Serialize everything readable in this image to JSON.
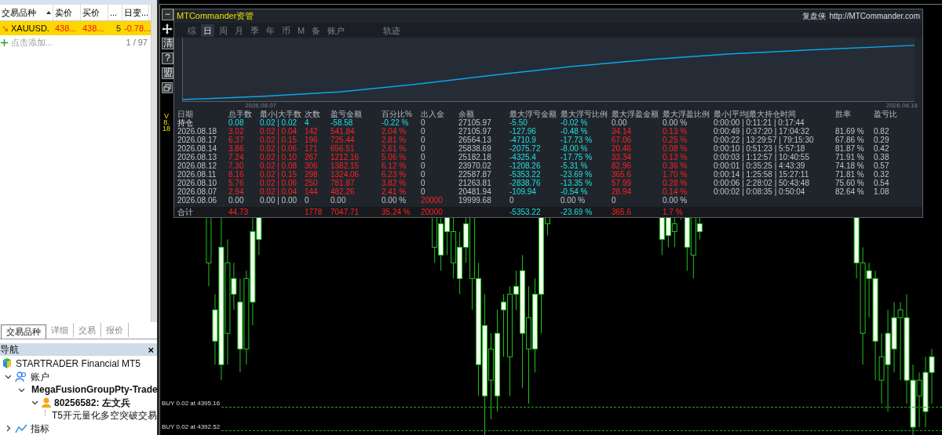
{
  "market_watch": {
    "columns": [
      {
        "label": "交易品种",
        "sorted": true
      },
      {
        "label": "卖价",
        "sorted": false
      },
      {
        "label": "买价",
        "sorted": false
      },
      {
        "label": "...",
        "sorted": false
      },
      {
        "label": "日变...",
        "sorted": false
      }
    ],
    "rows": [
      {
        "selected": true,
        "arrow": "↘",
        "cells": [
          "XAUUSD.",
          "438...",
          "438...",
          "5",
          "-0.78..."
        ]
      }
    ],
    "add_label": "点击添加...",
    "count": "1 / 97"
  },
  "bottom_tabs": [
    {
      "label": "交易品种",
      "selected": true
    },
    {
      "label": "详细",
      "selected": false
    },
    {
      "label": "交易",
      "selected": false
    },
    {
      "label": "报价",
      "selected": false
    }
  ],
  "navigator": {
    "title": "导航",
    "close": "×",
    "tree": [
      {
        "label": "STARTRADER Financial MT5",
        "kind": "broker",
        "bold": false,
        "children": [
          {
            "label": "账户",
            "kind": "accounts",
            "bold": false,
            "expanded": true,
            "children": [
              {
                "label": "MegaFusionGroupPty-Trade",
                "kind": "server",
                "bold": true,
                "expanded": true,
                "children": [
                  {
                    "label": "80256582: 左文兵",
                    "kind": "user",
                    "bold": true,
                    "expanded": true,
                    "children": [
                      {
                        "label": "T5开元量化多空突破交易",
                        "kind": "expert",
                        "bold": false
                      }
                    ]
                  }
                ]
              }
            ]
          },
          {
            "label": "指标",
            "kind": "indicators",
            "bold": false,
            "expanded": false
          }
        ]
      }
    ]
  },
  "chart_toolbar": [
    {
      "kind": "minimize",
      "label": "−"
    },
    {
      "kind": "move"
    },
    {
      "kind": "text",
      "label": "清"
    },
    {
      "kind": "text",
      "label": "?"
    },
    {
      "kind": "text",
      "label": "盟"
    },
    {
      "kind": "restore"
    }
  ],
  "version": "V8.18",
  "panel": {
    "title": "MTCommander资管",
    "brand": "复盘侠",
    "url": "http://MTCommander.com",
    "tabs": [
      {
        "label": "综",
        "selected": false
      },
      {
        "label": "日",
        "selected": true
      },
      {
        "label": "周",
        "selected": false
      },
      {
        "label": "月",
        "selected": false
      },
      {
        "label": "季",
        "selected": false
      },
      {
        "label": "年",
        "selected": false
      },
      {
        "label": "币",
        "selected": false
      },
      {
        "label": "M",
        "selected": false
      },
      {
        "label": "备",
        "selected": false
      },
      {
        "label": "账户",
        "selected": false
      },
      {
        "label": "轨迹",
        "selected": false
      }
    ],
    "curve": {
      "start_label": "2026.08.07",
      "end_label": "2026.08.18"
    },
    "columns": [
      "日期",
      "总手数",
      "最小|大手数",
      "次数",
      "盈亏金额",
      "百分比%",
      "出入金",
      "余额",
      "最大浮亏金额",
      "最大浮亏比例",
      "最大浮盈金额",
      "最大浮盈比例",
      "最小|平均|最大持仓时间",
      "胜率",
      "盈亏比"
    ],
    "rows": [
      {
        "kind": "holding",
        "cells": [
          {
            "text": "持仓",
            "kind": "label"
          },
          {
            "text": "0.08",
            "kind": "down"
          },
          {
            "text": "0.02 | 0.02",
            "kind": "down"
          },
          {
            "text": "4",
            "kind": "down"
          },
          {
            "text": "-58.58",
            "kind": "down"
          },
          {
            "text": "-0.22 %",
            "kind": "down"
          },
          {
            "text": "0",
            "kind": "flat"
          },
          {
            "text": "27105.97",
            "kind": "flat"
          },
          {
            "text": "-5.50",
            "kind": "down"
          },
          {
            "text": "-0.02 %",
            "kind": "down"
          },
          {
            "text": "0.00",
            "kind": "flat"
          },
          {
            "text": "0.00 %",
            "kind": "flat"
          },
          {
            "text": "0:00:00 | 0:11:21 | 0:17:44",
            "kind": "flat"
          },
          null,
          null
        ]
      },
      {
        "kind": "day",
        "cells": [
          {
            "text": "2026.08.18",
            "kind": "flat"
          },
          {
            "text": "3.02",
            "kind": "up"
          },
          {
            "text": "0.02 | 0.04",
            "kind": "up"
          },
          {
            "text": "142",
            "kind": "up"
          },
          {
            "text": "541.84",
            "kind": "up"
          },
          {
            "text": "2.04 %",
            "kind": "up"
          },
          {
            "text": "0",
            "kind": "flat"
          },
          {
            "text": "27105.97",
            "kind": "flat"
          },
          {
            "text": "-127.96",
            "kind": "down"
          },
          {
            "text": "-0.48 %",
            "kind": "down"
          },
          {
            "text": "34.14",
            "kind": "up"
          },
          {
            "text": "0.13 %",
            "kind": "up"
          },
          {
            "text": "0:00:49 | 0:37:20 | 17:04:32",
            "kind": "flat"
          },
          {
            "text": "81.69 %",
            "kind": "flat"
          },
          {
            "text": "0.82",
            "kind": "flat"
          }
        ]
      },
      {
        "kind": "day",
        "cells": [
          {
            "text": "2026.08.17",
            "kind": "flat"
          },
          {
            "text": "6.37",
            "kind": "up"
          },
          {
            "text": "0.02 | 0.15",
            "kind": "up"
          },
          {
            "text": "196",
            "kind": "up"
          },
          {
            "text": "725.44",
            "kind": "up"
          },
          {
            "text": "2.81 %",
            "kind": "up"
          },
          {
            "text": "0",
            "kind": "flat"
          },
          {
            "text": "26564.13",
            "kind": "flat"
          },
          {
            "text": "-4710.9",
            "kind": "down"
          },
          {
            "text": "-17.73 %",
            "kind": "down"
          },
          {
            "text": "67.06",
            "kind": "up"
          },
          {
            "text": "0.25 %",
            "kind": "up"
          },
          {
            "text": "0:00:22 | 13:29:57 | 79:15:30",
            "kind": "flat"
          },
          {
            "text": "67.86 %",
            "kind": "flat"
          },
          {
            "text": "0.29",
            "kind": "flat"
          }
        ]
      },
      {
        "kind": "day",
        "cells": [
          {
            "text": "2026.08.14",
            "kind": "flat"
          },
          {
            "text": "3.86",
            "kind": "up"
          },
          {
            "text": "0.02 | 0.06",
            "kind": "up"
          },
          {
            "text": "171",
            "kind": "up"
          },
          {
            "text": "656.51",
            "kind": "up"
          },
          {
            "text": "2.61 %",
            "kind": "up"
          },
          {
            "text": "0",
            "kind": "flat"
          },
          {
            "text": "25838.69",
            "kind": "flat"
          },
          {
            "text": "-2075.72",
            "kind": "down"
          },
          {
            "text": "-8.00 %",
            "kind": "down"
          },
          {
            "text": "20.46",
            "kind": "up"
          },
          {
            "text": "0.08 %",
            "kind": "up"
          },
          {
            "text": "0:00:10 | 0:51:23 | 5:57:18",
            "kind": "flat"
          },
          {
            "text": "81.87 %",
            "kind": "flat"
          },
          {
            "text": "0.42",
            "kind": "flat"
          }
        ]
      },
      {
        "kind": "day",
        "cells": [
          {
            "text": "2026.08.13",
            "kind": "flat"
          },
          {
            "text": "7.24",
            "kind": "up"
          },
          {
            "text": "0.02 | 0.10",
            "kind": "up"
          },
          {
            "text": "267",
            "kind": "up"
          },
          {
            "text": "1212.16",
            "kind": "up"
          },
          {
            "text": "5.06 %",
            "kind": "up"
          },
          {
            "text": "0",
            "kind": "flat"
          },
          {
            "text": "25182.18",
            "kind": "flat"
          },
          {
            "text": "-4325.4",
            "kind": "down"
          },
          {
            "text": "-17.75 %",
            "kind": "down"
          },
          {
            "text": "33.34",
            "kind": "up"
          },
          {
            "text": "0.13 %",
            "kind": "up"
          },
          {
            "text": "0:00:03 | 1:12:57 | 10:40:55",
            "kind": "flat"
          },
          {
            "text": "71.91 %",
            "kind": "flat"
          },
          {
            "text": "0.38",
            "kind": "flat"
          }
        ]
      },
      {
        "kind": "day",
        "cells": [
          {
            "text": "2026.08.12",
            "kind": "flat"
          },
          {
            "text": "7.30",
            "kind": "up"
          },
          {
            "text": "0.02 | 0.08",
            "kind": "up"
          },
          {
            "text": "306",
            "kind": "up"
          },
          {
            "text": "1382.15",
            "kind": "up"
          },
          {
            "text": "6.12 %",
            "kind": "up"
          },
          {
            "text": "0",
            "kind": "flat"
          },
          {
            "text": "23970.02",
            "kind": "flat"
          },
          {
            "text": "-1208.26",
            "kind": "down"
          },
          {
            "text": "-5.31 %",
            "kind": "down"
          },
          {
            "text": "82.96",
            "kind": "up"
          },
          {
            "text": "0.36 %",
            "kind": "up"
          },
          {
            "text": "0:00:01 | 0:35:25 | 4:43:39",
            "kind": "flat"
          },
          {
            "text": "74.18 %",
            "kind": "flat"
          },
          {
            "text": "0.57",
            "kind": "flat"
          }
        ]
      },
      {
        "kind": "day",
        "cells": [
          {
            "text": "2026.08.11",
            "kind": "flat"
          },
          {
            "text": "8.16",
            "kind": "up"
          },
          {
            "text": "0.02 | 0.15",
            "kind": "up"
          },
          {
            "text": "298",
            "kind": "up"
          },
          {
            "text": "1324.06",
            "kind": "up"
          },
          {
            "text": "6.23 %",
            "kind": "up"
          },
          {
            "text": "0",
            "kind": "flat"
          },
          {
            "text": "22587.87",
            "kind": "flat"
          },
          {
            "text": "-5353.22",
            "kind": "down"
          },
          {
            "text": "-23.69 %",
            "kind": "down"
          },
          {
            "text": "365.6",
            "kind": "up"
          },
          {
            "text": "1.70 %",
            "kind": "up"
          },
          {
            "text": "0:00:14 | 1:25:58 | 15:27:11",
            "kind": "flat"
          },
          {
            "text": "71.81 %",
            "kind": "flat"
          },
          {
            "text": "0.32",
            "kind": "flat"
          }
        ]
      },
      {
        "kind": "day",
        "cells": [
          {
            "text": "2026.08.10",
            "kind": "flat"
          },
          {
            "text": "5.76",
            "kind": "up"
          },
          {
            "text": "0.02 | 0.06",
            "kind": "up"
          },
          {
            "text": "250",
            "kind": "up"
          },
          {
            "text": "781.87",
            "kind": "up"
          },
          {
            "text": "3.82 %",
            "kind": "up"
          },
          {
            "text": "0",
            "kind": "flat"
          },
          {
            "text": "21263.81",
            "kind": "flat"
          },
          {
            "text": "-2838.76",
            "kind": "down"
          },
          {
            "text": "-13.35 %",
            "kind": "down"
          },
          {
            "text": "57.99",
            "kind": "up"
          },
          {
            "text": "0.28 %",
            "kind": "up"
          },
          {
            "text": "0:00:06 | 2:28:02 | 50:43:48",
            "kind": "flat"
          },
          {
            "text": "75.60 %",
            "kind": "flat"
          },
          {
            "text": "0.54",
            "kind": "flat"
          }
        ]
      },
      {
        "kind": "day",
        "cells": [
          {
            "text": "2026.08.07",
            "kind": "flat"
          },
          {
            "text": "2.94",
            "kind": "up"
          },
          {
            "text": "0.02 | 0.04",
            "kind": "up"
          },
          {
            "text": "144",
            "kind": "up"
          },
          {
            "text": "482.26",
            "kind": "up"
          },
          {
            "text": "2.41 %",
            "kind": "up"
          },
          {
            "text": "0",
            "kind": "flat"
          },
          {
            "text": "20481.94",
            "kind": "flat"
          },
          {
            "text": "-109.94",
            "kind": "down"
          },
          {
            "text": "-0.54 %",
            "kind": "down"
          },
          {
            "text": "28.94",
            "kind": "up"
          },
          {
            "text": "0.14 %",
            "kind": "up"
          },
          {
            "text": "0:00:02 | 0:08:35 | 0:50:04",
            "kind": "flat"
          },
          {
            "text": "82.64 %",
            "kind": "flat"
          },
          {
            "text": "1.08",
            "kind": "flat"
          }
        ]
      },
      {
        "kind": "day",
        "cells": [
          {
            "text": "2026.08.06",
            "kind": "flat"
          },
          {
            "text": "0.00",
            "kind": "flat"
          },
          {
            "text": "0.00 | 0.00",
            "kind": "flat"
          },
          {
            "text": "0",
            "kind": "flat"
          },
          {
            "text": "0.00",
            "kind": "flat"
          },
          {
            "text": "0.00 %",
            "kind": "flat"
          },
          {
            "text": "20000",
            "kind": "up"
          },
          {
            "text": "19999.68",
            "kind": "flat"
          },
          {
            "text": "0",
            "kind": "flat"
          },
          {
            "text": "0.00 %",
            "kind": "flat"
          },
          {
            "text": "0",
            "kind": "flat"
          },
          {
            "text": "0.00 %",
            "kind": "flat"
          },
          null,
          null,
          null
        ]
      },
      {
        "kind": "total",
        "cells": [
          {
            "text": "合计",
            "kind": "flat"
          },
          {
            "text": "44.73",
            "kind": "up"
          },
          null,
          {
            "text": "1778",
            "kind": "up"
          },
          {
            "text": "7047.71",
            "kind": "up"
          },
          {
            "text": "35.24 %",
            "kind": "up"
          },
          {
            "text": "20000",
            "kind": "up"
          },
          null,
          {
            "text": "-5353.22",
            "kind": "down"
          },
          {
            "text": "-23.69 %",
            "kind": "down"
          },
          {
            "text": "365.6",
            "kind": "up"
          },
          {
            "text": "1.7 %",
            "kind": "up"
          },
          null,
          null,
          null
        ]
      }
    ]
  },
  "orders": [
    {
      "label": "BUY 0.02 at 4395.16"
    },
    {
      "label": "BUY 0.02 at 4392.52"
    }
  ]
}
